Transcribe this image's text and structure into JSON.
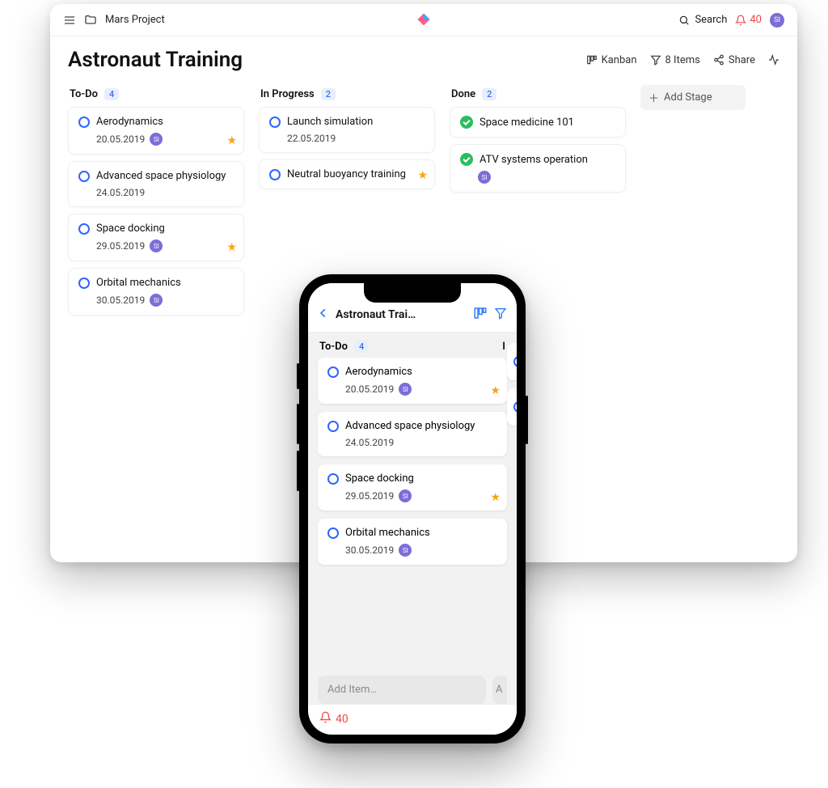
{
  "header": {
    "folder": "Mars Project",
    "search_label": "Search",
    "notif_count": "40",
    "avatar": "SI"
  },
  "page": {
    "title": "Astronaut Training",
    "tools": {
      "view": "Kanban",
      "items": "8 Items",
      "share": "Share"
    },
    "add_stage": "Add Stage"
  },
  "columns": [
    {
      "name": "To-Do",
      "count": "4",
      "cards": [
        {
          "title": "Aerodynamics",
          "date": "20.05.2019",
          "assignee": "SI",
          "starred": true,
          "done": false
        },
        {
          "title": "Advanced space physiology",
          "date": "24.05.2019",
          "assignee": null,
          "starred": false,
          "done": false
        },
        {
          "title": "Space docking",
          "date": "29.05.2019",
          "assignee": "SI",
          "starred": true,
          "done": false
        },
        {
          "title": "Orbital mechanics",
          "date": "30.05.2019",
          "assignee": "SI",
          "starred": false,
          "done": false
        }
      ]
    },
    {
      "name": "In Progress",
      "count": "2",
      "cards": [
        {
          "title": "Launch simulation",
          "date": "22.05.2019",
          "assignee": null,
          "starred": false,
          "done": false
        },
        {
          "title": "Neutral buoyancy training",
          "date": null,
          "assignee": null,
          "starred": true,
          "done": false
        }
      ]
    },
    {
      "name": "Done",
      "count": "2",
      "cards": [
        {
          "title": "Space medicine 101",
          "date": null,
          "assignee": null,
          "starred": false,
          "done": true
        },
        {
          "title": "ATV systems operation",
          "date": null,
          "assignee": "SI",
          "starred": false,
          "done": true
        }
      ]
    }
  ],
  "mobile": {
    "title": "Astronaut Trai…",
    "column": {
      "name": "To-Do",
      "count": "4"
    },
    "next_col_initial": "I",
    "cards": [
      {
        "title": "Aerodynamics",
        "date": "20.05.2019",
        "assignee": "SI",
        "starred": true
      },
      {
        "title": "Advanced space physiology",
        "date": "24.05.2019",
        "assignee": null,
        "starred": false
      },
      {
        "title": "Space docking",
        "date": "29.05.2019",
        "assignee": "SI",
        "starred": true
      },
      {
        "title": "Orbital mechanics",
        "date": "30.05.2019",
        "assignee": "SI",
        "starred": false
      }
    ],
    "add_item_placeholder": "Add Item…",
    "add_item_peek": "A",
    "notif_count": "40"
  }
}
